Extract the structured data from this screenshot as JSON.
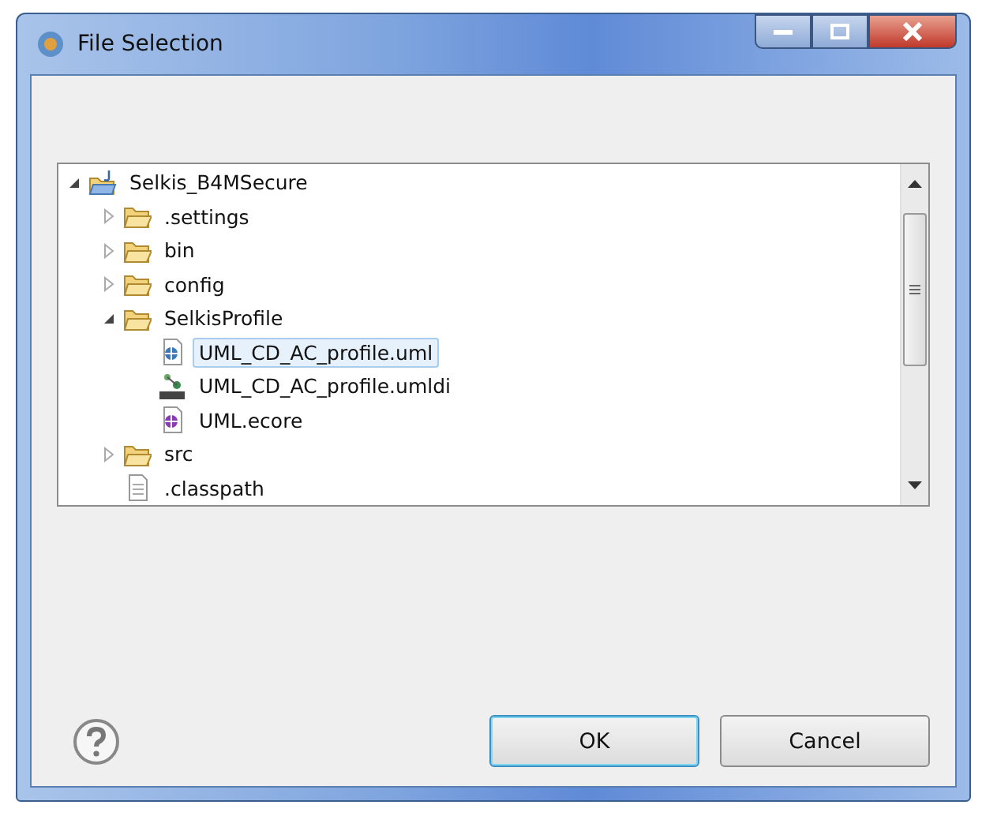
{
  "window": {
    "title": "File Selection"
  },
  "tree": [
    {
      "label": "Selkis_B4MSecure",
      "kind": "project",
      "expanded": true,
      "selected": false,
      "children": [
        {
          "label": ".settings",
          "kind": "folder",
          "expanded": false,
          "selected": false
        },
        {
          "label": "bin",
          "kind": "folder",
          "expanded": false,
          "selected": false
        },
        {
          "label": "config",
          "kind": "folder",
          "expanded": false,
          "selected": false
        },
        {
          "label": "SelkisProfile",
          "kind": "folder",
          "expanded": true,
          "selected": false,
          "children": [
            {
              "label": "UML_CD_AC_profile.uml",
              "kind": "uml",
              "selected": true
            },
            {
              "label": "UML_CD_AC_profile.umldi",
              "kind": "umldi",
              "selected": false
            },
            {
              "label": "UML.ecore",
              "kind": "ecore",
              "selected": false
            }
          ]
        },
        {
          "label": "src",
          "kind": "folder",
          "expanded": false,
          "selected": false
        },
        {
          "label": ".classpath",
          "kind": "file",
          "selected": false
        }
      ]
    }
  ],
  "buttons": [
    {
      "label": "OK",
      "default": true
    },
    {
      "label": "Cancel",
      "default": false
    }
  ]
}
